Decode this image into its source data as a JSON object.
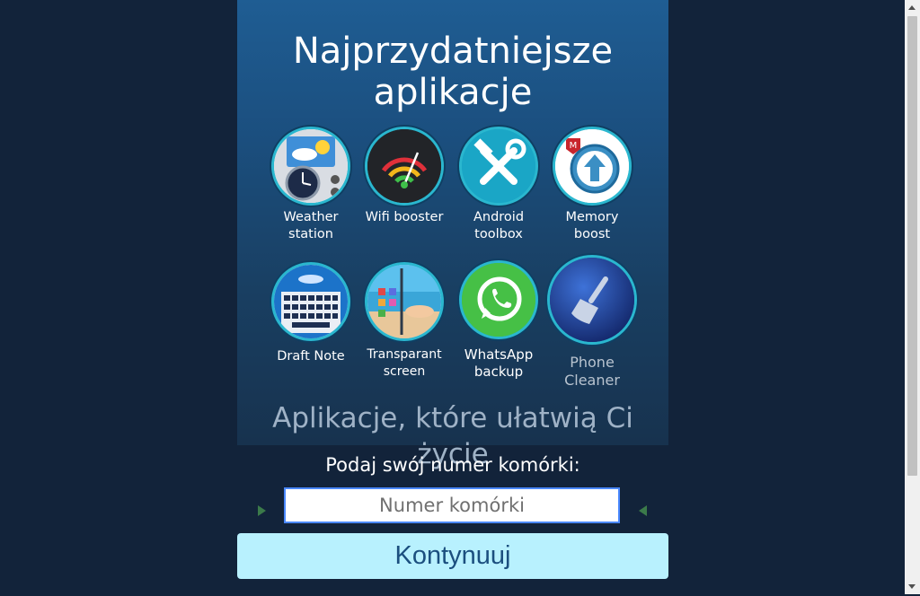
{
  "headline": {
    "line1": "Najprzydatniejsze",
    "line2": "aplikacje"
  },
  "apps": [
    {
      "name": "Weather station",
      "line1": "Weather",
      "line2": "station",
      "icon": "weather-clock-icon"
    },
    {
      "name": "Wifi booster",
      "line1": "Wifi booster",
      "line2": "",
      "icon": "wifi-gauge-icon"
    },
    {
      "name": "Android toolbox",
      "line1": "Android",
      "line2": "toolbox",
      "icon": "tools-icon"
    },
    {
      "name": "Memory boost",
      "line1": "Memory",
      "line2": "boost",
      "icon": "upload-arrow-icon"
    },
    {
      "name": "Draft Note",
      "line1": "Draft Note",
      "line2": "",
      "icon": "keyboard-icon"
    },
    {
      "name": "Transparant screen",
      "line1": "Transparant",
      "line2": "screen",
      "icon": "transparent-screen-icon"
    },
    {
      "name": "WhatsApp backup",
      "line1": "WhatsApp",
      "line2": "backup",
      "icon": "whatsapp-icon"
    },
    {
      "name": "Phone Cleaner",
      "line1": "Phone",
      "line2": "Cleaner",
      "icon": "broom-icon"
    }
  ],
  "tagline": "Aplikacje, które ułatwią Ci życie",
  "form": {
    "prompt": "Podaj swój numer komórki:",
    "phone_placeholder": "Numer komórki",
    "phone_value": "",
    "submit_label": "Kontynuuj"
  },
  "colors": {
    "page_bg": "#12233a",
    "panel_top": "#1f5d93",
    "ring": "#2ab7cf",
    "button_bg": "#b8f1fe",
    "button_text": "#1b4f7f"
  }
}
